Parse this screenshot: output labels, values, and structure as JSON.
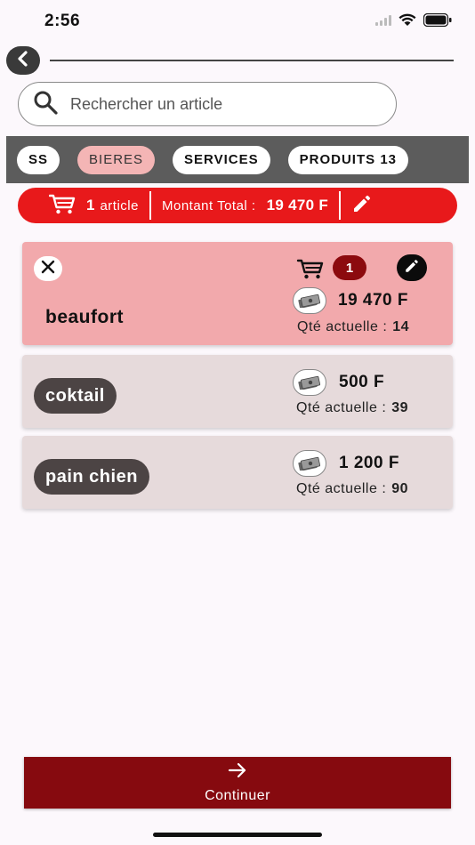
{
  "status_bar": {
    "time": "2:56",
    "icons": [
      "signal-icon",
      "wifi-icon",
      "battery-icon"
    ]
  },
  "search": {
    "placeholder": "Rechercher un article"
  },
  "categories": [
    {
      "label": "SS",
      "active": false
    },
    {
      "label": "BIERES",
      "active": true
    },
    {
      "label": "SERVICES",
      "active": false
    },
    {
      "label": "PRODUITS 13",
      "active": false
    }
  ],
  "summary": {
    "count": "1",
    "unit": "article",
    "total_label": "Montant Total :",
    "total_value": "19 470 F"
  },
  "items": [
    {
      "name": "beaufort",
      "price": "19 470 F",
      "stock_label": "Qté actuelle :",
      "stock": "14",
      "qty": "1",
      "selected": true
    },
    {
      "name": "coktail",
      "price": "500 F",
      "stock_label": "Qté actuelle :",
      "stock": "39",
      "selected": false
    },
    {
      "name": "pain chien",
      "price": "1 200 F",
      "stock_label": "Qté actuelle :",
      "stock": "90",
      "selected": false
    }
  ],
  "footer": {
    "continue_label": "Continuer"
  },
  "colors": {
    "accent_red": "#e8191b",
    "dark_red": "#860a0f",
    "selected_card": "#f2a9ac",
    "normal_card": "#e6dadb"
  }
}
